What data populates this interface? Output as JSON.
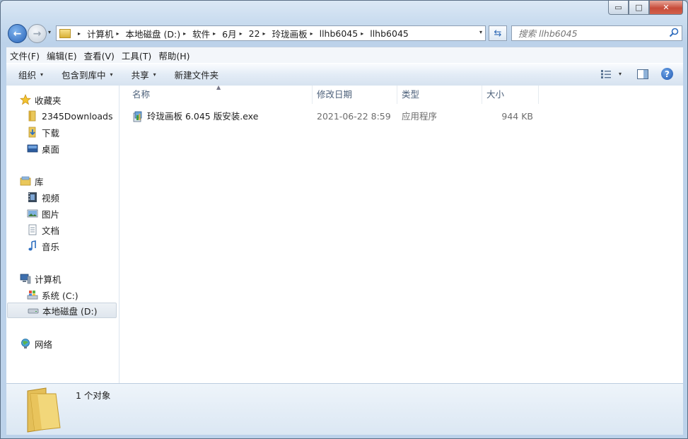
{
  "window": {
    "controls": {
      "minimize": "▭",
      "maximize": "□",
      "close": "✕"
    }
  },
  "nav": {
    "back_glyph": "←",
    "forward_glyph": "→",
    "history_dropdown": "▾",
    "breadcrumb": [
      "计算机",
      "本地磁盘 (D:)",
      "软件",
      "6月",
      "22",
      "玲珑画板",
      "llhb6045",
      "llhb6045"
    ],
    "breadcrumb_sep": "▸",
    "address_dropdown": "▾",
    "refresh_glyph": "⇆",
    "search_placeholder": "搜索 llhb6045"
  },
  "menubar": {
    "items": [
      "文件(F)",
      "编辑(E)",
      "查看(V)",
      "工具(T)",
      "帮助(H)"
    ]
  },
  "toolbar": {
    "items": [
      {
        "label": "组织",
        "caret": "▾"
      },
      {
        "label": "包含到库中",
        "caret": "▾"
      },
      {
        "label": "共享",
        "caret": "▾"
      },
      {
        "label": "新建文件夹",
        "caret": ""
      }
    ],
    "views_caret": "▾",
    "help_glyph": "?"
  },
  "sidebar": {
    "favorites": {
      "label": "收藏夹",
      "items": [
        "2345Downloads",
        "下载",
        "桌面"
      ]
    },
    "libraries": {
      "label": "库",
      "items": [
        "视频",
        "图片",
        "文档",
        "音乐"
      ]
    },
    "computer": {
      "label": "计算机",
      "items": [
        "系统 (C:)",
        "本地磁盘 (D:)"
      ]
    },
    "network": {
      "label": "网络"
    },
    "selected": "本地磁盘 (D:)"
  },
  "columns": {
    "name": "名称",
    "date": "修改日期",
    "type": "类型",
    "size": "大小",
    "sort_indicator": "▲"
  },
  "files": [
    {
      "name": "玲珑画板 6.045 版安装.exe",
      "date": "2021-06-22 8:59",
      "type": "应用程序",
      "size": "944 KB"
    }
  ],
  "status": {
    "text": "1 个对象"
  },
  "colors": {
    "accent": "#2a64b8",
    "selected_bg": "#dfe6ee",
    "header_text": "#4c607a"
  }
}
